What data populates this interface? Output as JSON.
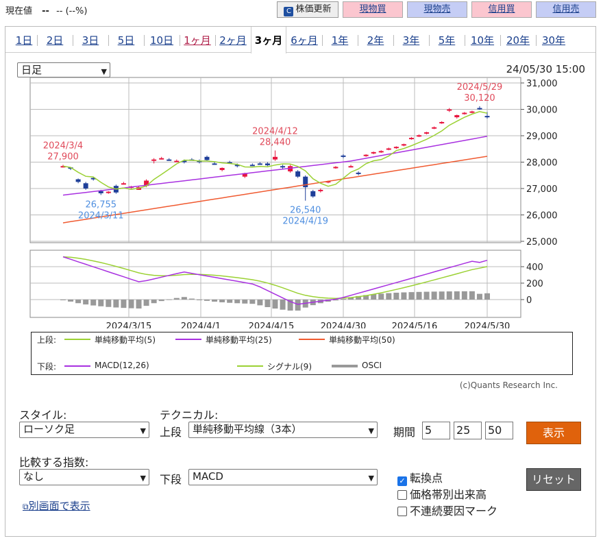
{
  "topbar": {
    "price_label": "現在値",
    "price_value": "--",
    "price_change": "-- (--%)",
    "update_button": "株価更新",
    "buttons": [
      "現物買",
      "現物売",
      "信用買",
      "信用売"
    ]
  },
  "tabs": [
    "1日",
    "2日",
    "3日",
    "5日",
    "10日",
    "1ヶ月",
    "2ヶ月",
    "3ヶ月",
    "6ヶ月",
    "1年",
    "2年",
    "3年",
    "5年",
    "10年",
    "20年",
    "30年"
  ],
  "active_tab": "3ヶ月",
  "period_select": "日足",
  "datetime": "24/05/30 15:00",
  "chart_data": {
    "type": "candlestick",
    "y_ticks": [
      "31,000",
      "30,000",
      "29,000",
      "28,000",
      "27,000",
      "26,000",
      "25,000"
    ],
    "ylim": [
      25000,
      31000
    ],
    "x_labels": [
      "2024/3/15",
      "2024/4/1",
      "2024/4/15",
      "2024/4/30",
      "2024/5/16",
      "2024/5/30"
    ],
    "annotations": [
      {
        "date": "2024/3/4",
        "value": "27,900",
        "kind": "high"
      },
      {
        "date": "2024/3/11",
        "value": "26,755",
        "kind": "low"
      },
      {
        "date": "2024/4/12",
        "value": "28,440",
        "kind": "high"
      },
      {
        "date": "2024/4/19",
        "value": "26,540",
        "kind": "low"
      },
      {
        "date": "2024/5/29",
        "value": "30,120",
        "kind": "high"
      }
    ],
    "candles": [
      [
        27850,
        27900,
        27800,
        27850
      ],
      [
        27800,
        27820,
        27700,
        27750
      ],
      [
        27350,
        27380,
        27200,
        27250
      ],
      [
        27200,
        27250,
        26950,
        27000
      ],
      [
        27400,
        27450,
        27300,
        27350
      ],
      [
        26900,
        26950,
        26755,
        26820
      ],
      [
        26850,
        26900,
        26800,
        26880
      ],
      [
        27100,
        27150,
        26800,
        26850
      ],
      [
        27200,
        27250,
        27150,
        27200
      ],
      [
        27050,
        27100,
        27000,
        27080
      ],
      [
        26950,
        27100,
        26950,
        27050
      ],
      [
        27100,
        27350,
        27050,
        27300
      ],
      [
        28050,
        28150,
        27950,
        28100
      ],
      [
        28150,
        28200,
        28100,
        28150
      ],
      [
        28100,
        28150,
        28050,
        28080
      ],
      [
        28050,
        28100,
        28000,
        28050
      ],
      [
        28050,
        28100,
        27950,
        28000
      ],
      [
        28100,
        28150,
        28050,
        28080
      ],
      [
        28050,
        28100,
        27950,
        28000
      ],
      [
        28200,
        28250,
        28050,
        28080
      ],
      [
        27950,
        28000,
        27900,
        27920
      ],
      [
        27700,
        27800,
        27650,
        27780
      ],
      [
        28000,
        28050,
        27950,
        27960
      ],
      [
        27900,
        27950,
        27800,
        27850
      ],
      [
        27450,
        27600,
        27400,
        27580
      ],
      [
        27900,
        27950,
        27850,
        27880
      ],
      [
        27950,
        28000,
        27900,
        27920
      ],
      [
        27950,
        28000,
        27850,
        27880
      ],
      [
        28100,
        28440,
        28050,
        28200
      ],
      [
        27850,
        27900,
        27750,
        27800
      ],
      [
        27650,
        27900,
        27600,
        27850
      ],
      [
        27650,
        27700,
        27400,
        27450
      ],
      [
        27450,
        27500,
        26540,
        27050
      ],
      [
        26900,
        26950,
        26650,
        26700
      ],
      [
        26900,
        27000,
        26850,
        26950
      ],
      [
        27250,
        27300,
        27200,
        27280
      ],
      [
        27800,
        27850,
        27750,
        27820
      ],
      [
        28250,
        28300,
        28150,
        28200
      ],
      [
        27850,
        27900,
        27800,
        27850
      ],
      [
        27600,
        27650,
        27500,
        27550
      ],
      [
        28250,
        28300,
        28200,
        28280
      ],
      [
        28350,
        28400,
        28300,
        28380
      ],
      [
        28400,
        28450,
        28350,
        28420
      ],
      [
        28500,
        28550,
        28450,
        28520
      ],
      [
        28550,
        28600,
        28500,
        28580
      ],
      [
        28650,
        28700,
        28600,
        28680
      ],
      [
        28900,
        28950,
        28850,
        28920
      ],
      [
        29000,
        29050,
        28950,
        29020
      ],
      [
        29100,
        29150,
        29050,
        29130
      ],
      [
        29300,
        29350,
        29250,
        29320
      ],
      [
        29500,
        29550,
        29450,
        29520
      ],
      [
        29950,
        30050,
        29900,
        30000
      ],
      [
        29700,
        29800,
        29650,
        29780
      ],
      [
        29850,
        29900,
        29800,
        29870
      ],
      [
        29900,
        29950,
        29850,
        29920
      ],
      [
        30050,
        30120,
        29980,
        30000
      ],
      [
        29750,
        29900,
        29650,
        29700
      ]
    ],
    "osci_ticks": [
      "400",
      "200",
      "0"
    ],
    "legend_upper": {
      "label": "上段:",
      "items": [
        "単純移動平均(5)",
        "単純移動平均(25)",
        "単純移動平均(50)"
      ]
    },
    "legend_lower": {
      "label": "下段:",
      "items": [
        "MACD(12,26)",
        "シグナル(9)",
        "OSCI"
      ]
    },
    "colors": {
      "up": "#e8163e",
      "down": "#1f3f99",
      "ma5": "#9bd133",
      "ma25": "#a830e0",
      "ma50": "#f05a30",
      "macd": "#a830e0",
      "signal": "#9bd133",
      "osci": "#999999"
    }
  },
  "copyright": "(c)Quants Research Inc.",
  "controls": {
    "style_label": "スタイル:",
    "style_value": "ローソク足",
    "technical_label": "テクニカル:",
    "upper_label": "上段",
    "upper_value": "単純移動平均線（3本）",
    "period_label": "期間",
    "periods": [
      "5",
      "25",
      "50"
    ],
    "show_button": "表示",
    "compare_label": "比較する指数:",
    "compare_value": "なし",
    "lower_label": "下段",
    "lower_value": "MACD",
    "reset_button": "リセット",
    "checkboxes": [
      {
        "label": "転換点",
        "checked": true
      },
      {
        "label": "価格帯別出来高",
        "checked": false
      },
      {
        "label": "不連続要因マーク",
        "checked": false
      }
    ],
    "new_window_link": "別画面で表示"
  }
}
